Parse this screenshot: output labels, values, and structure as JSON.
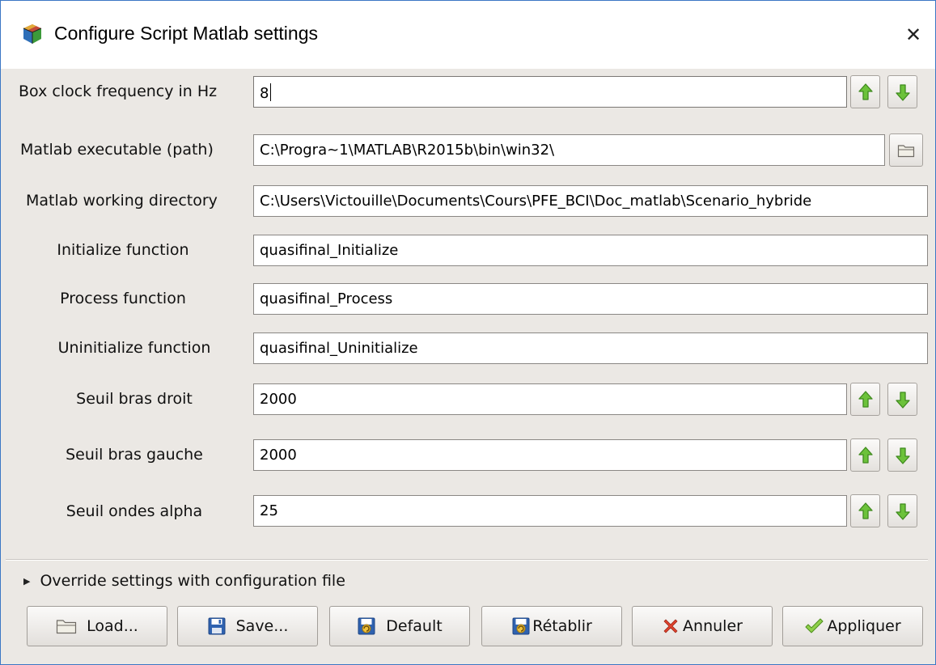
{
  "window": {
    "title": "Configure Script Matlab settings"
  },
  "settings": [
    {
      "label": "Box clock frequency in Hz",
      "value": "8"
    },
    {
      "label": "Matlab executable (path)",
      "value": "C:\\Progra~1\\MATLAB\\R2015b\\bin\\win32\\"
    },
    {
      "label": "Matlab working directory",
      "value": "C:\\Users\\Victouille\\Documents\\Cours\\PFE_BCI\\Doc_matlab\\Scenario_hybride"
    },
    {
      "label": "Initialize function",
      "value": "quasifinal_Initialize"
    },
    {
      "label": "Process function",
      "value": "quasifinal_Process"
    },
    {
      "label": "Uninitialize function",
      "value": "quasifinal_Uninitialize"
    },
    {
      "label": "Seuil bras droit",
      "value": "2000"
    },
    {
      "label": "Seuil bras gauche",
      "value": "2000"
    },
    {
      "label": "Seuil ondes alpha",
      "value": "25"
    }
  ],
  "override": {
    "label": "Override settings with configuration file"
  },
  "buttons": {
    "load": "Load...",
    "save": "Save...",
    "default": "Default",
    "retablir": "Rétablir",
    "annuler": "Annuler",
    "appliquer": "Appliquer"
  },
  "icons": {
    "spin_up": "green-up-arrow-icon",
    "spin_down": "green-down-arrow-icon",
    "browse": "folder-icon",
    "load": "folder-icon",
    "save": "floppy-disk-icon",
    "default": "revert-icon",
    "retablir": "revert-icon",
    "annuler": "red-x-icon",
    "appliquer": "green-check-icon"
  },
  "colors": {
    "accent_green": "#5cb82e",
    "cancel_red": "#d6402c",
    "window_border": "#3b77c4"
  }
}
